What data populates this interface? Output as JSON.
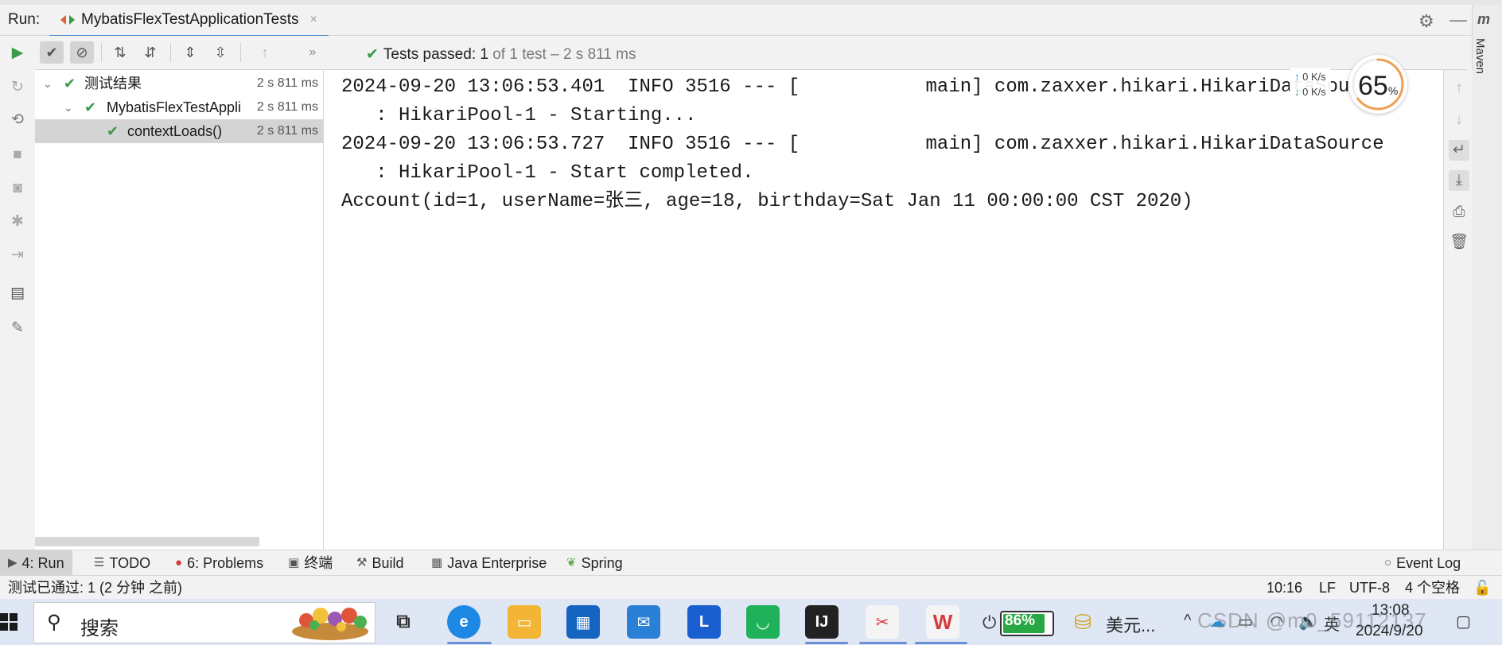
{
  "run_header": {
    "run_label": "Run:",
    "tab_title": "MybatisFlexTestApplicationTests",
    "tab_close": "×"
  },
  "maven": {
    "label": "Maven",
    "glyph": "m"
  },
  "test_toolbar": {
    "status_label": "Tests passed: 1",
    "status_detail": "of 1 test – 2 s 811 ms"
  },
  "tree": {
    "rows": [
      {
        "label": "测试结果",
        "time": "2 s 811 ms"
      },
      {
        "label": "MybatisFlexTestAppli",
        "time": "2 s 811 ms"
      },
      {
        "label": "contextLoads()",
        "time": "2 s 811 ms"
      }
    ]
  },
  "console": {
    "lines": [
      "2024-09-20 13:06:53.401  INFO 3516 --- [           main] com.zaxxer.hikari.HikariDataSource",
      "   : HikariPool-1 - Starting...",
      "2024-09-20 13:06:53.727  INFO 3516 --- [           main] com.zaxxer.hikari.HikariDataSource",
      "   : HikariPool-1 - Start completed.",
      "Account(id=1, userName=张三, age=18, birthday=Sat Jan 11 00:00:00 CST 2020)"
    ]
  },
  "net_widget": {
    "up_rate": "0  K/s",
    "down_rate": "0  K/s",
    "cpu_percent": "65",
    "cpu_unit": "%"
  },
  "tool_windows": [
    {
      "label": "4: Run",
      "icon": "play-icon"
    },
    {
      "label": "TODO",
      "icon": "list-icon"
    },
    {
      "label": "6: Problems",
      "icon": "error-icon"
    },
    {
      "label": "终端",
      "icon": "terminal-icon"
    },
    {
      "label": "Build",
      "icon": "hammer-icon"
    },
    {
      "label": "Java Enterprise",
      "icon": "java-enterprise-icon"
    },
    {
      "label": "Spring",
      "icon": "spring-icon"
    },
    {
      "label": "Event Log",
      "icon": "event-log-icon"
    }
  ],
  "status_bar": {
    "message": "测试已通过: 1 (2 分钟 之前)",
    "position": "10:16",
    "line_sep": "LF",
    "encoding": "UTF-8",
    "indent": "4 个空格"
  },
  "taskbar": {
    "search_placeholder": "搜索",
    "battery_percent": "86%",
    "battery_level": 0.86,
    "coin_label": "美元...",
    "ime": "英",
    "clock_time": "13:08",
    "clock_date": "2024/9/20",
    "watermark": "CSDN @m0_59112137"
  },
  "colors": {
    "accent_blue": "#4083c9",
    "pass_green": "#3c9a47",
    "error_red": "#d63b3b",
    "selection_gray": "#d4d4d4"
  }
}
